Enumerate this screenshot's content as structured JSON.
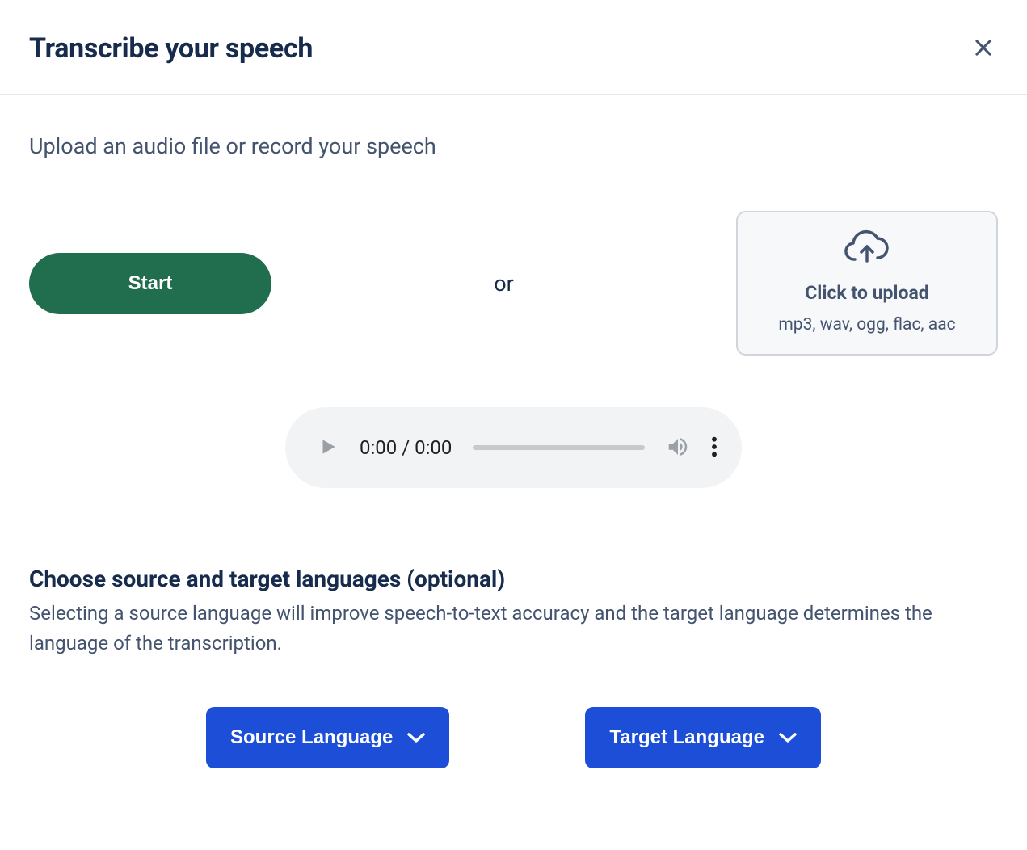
{
  "header": {
    "title": "Transcribe your speech"
  },
  "instruction": "Upload an audio file or record your speech",
  "startButton": {
    "label": "Start"
  },
  "orLabel": "or",
  "upload": {
    "title": "Click to upload",
    "formats": "mp3, wav, ogg, flac, aac"
  },
  "audio": {
    "currentTime": "0:00",
    "duration": "0:00"
  },
  "languages": {
    "heading": "Choose source and target languages (optional)",
    "description": "Selecting a source language will improve speech-to-text accuracy and the target language determines the language of the transcription.",
    "sourceLabel": "Source Language",
    "targetLabel": "Target Language"
  }
}
